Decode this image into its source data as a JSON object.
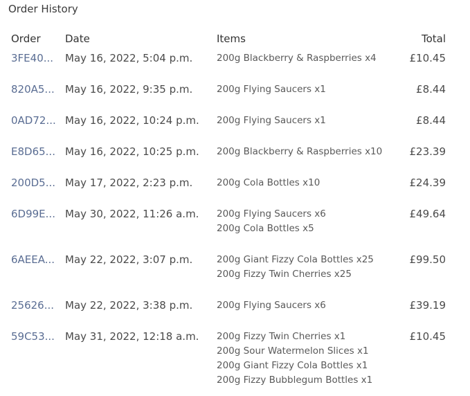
{
  "page": {
    "title": "Order History"
  },
  "table": {
    "headers": {
      "order": "Order",
      "date": "Date",
      "items": "Items",
      "total": "Total"
    },
    "rows": [
      {
        "id": "3FE40...",
        "date": "May 16, 2022, 5:04 p.m.",
        "items": [
          "200g Blackberry & Raspberries x4"
        ],
        "total": "£10.45"
      },
      {
        "id": "820A5...",
        "date": "May 16, 2022, 9:35 p.m.",
        "items": [
          "200g Flying Saucers x1"
        ],
        "total": "£8.44"
      },
      {
        "id": "0AD72...",
        "date": "May 16, 2022, 10:24 p.m.",
        "items": [
          "200g Flying Saucers x1"
        ],
        "total": "£8.44"
      },
      {
        "id": "E8D65...",
        "date": "May 16, 2022, 10:25 p.m.",
        "items": [
          "200g Blackberry & Raspberries x10"
        ],
        "total": "£23.39"
      },
      {
        "id": "200D5...",
        "date": "May 17, 2022, 2:23 p.m.",
        "items": [
          "200g Cola Bottles x10"
        ],
        "total": "£24.39"
      },
      {
        "id": "6D99E...",
        "date": "May 30, 2022, 11:26 a.m.",
        "items": [
          "200g Flying Saucers x6",
          "200g Cola Bottles x5"
        ],
        "total": "£49.64"
      },
      {
        "id": "6AEEA...",
        "date": "May 22, 2022, 3:07 p.m.",
        "items": [
          "200g Giant Fizzy Cola Bottles x25",
          "200g Fizzy Twin Cherries x25"
        ],
        "total": "£99.50"
      },
      {
        "id": "25626...",
        "date": "May 22, 2022, 3:38 p.m.",
        "items": [
          "200g Flying Saucers x6"
        ],
        "total": "£39.19"
      },
      {
        "id": "59C53...",
        "date": "May 31, 2022, 12:18 a.m.",
        "items": [
          "200g Fizzy Twin Cherries x1",
          "200g Sour Watermelon Slices x1",
          "200g Giant Fizzy Cola Bottles x1",
          "200g Fizzy Bubblegum Bottles x1"
        ],
        "total": "£10.45"
      }
    ]
  }
}
